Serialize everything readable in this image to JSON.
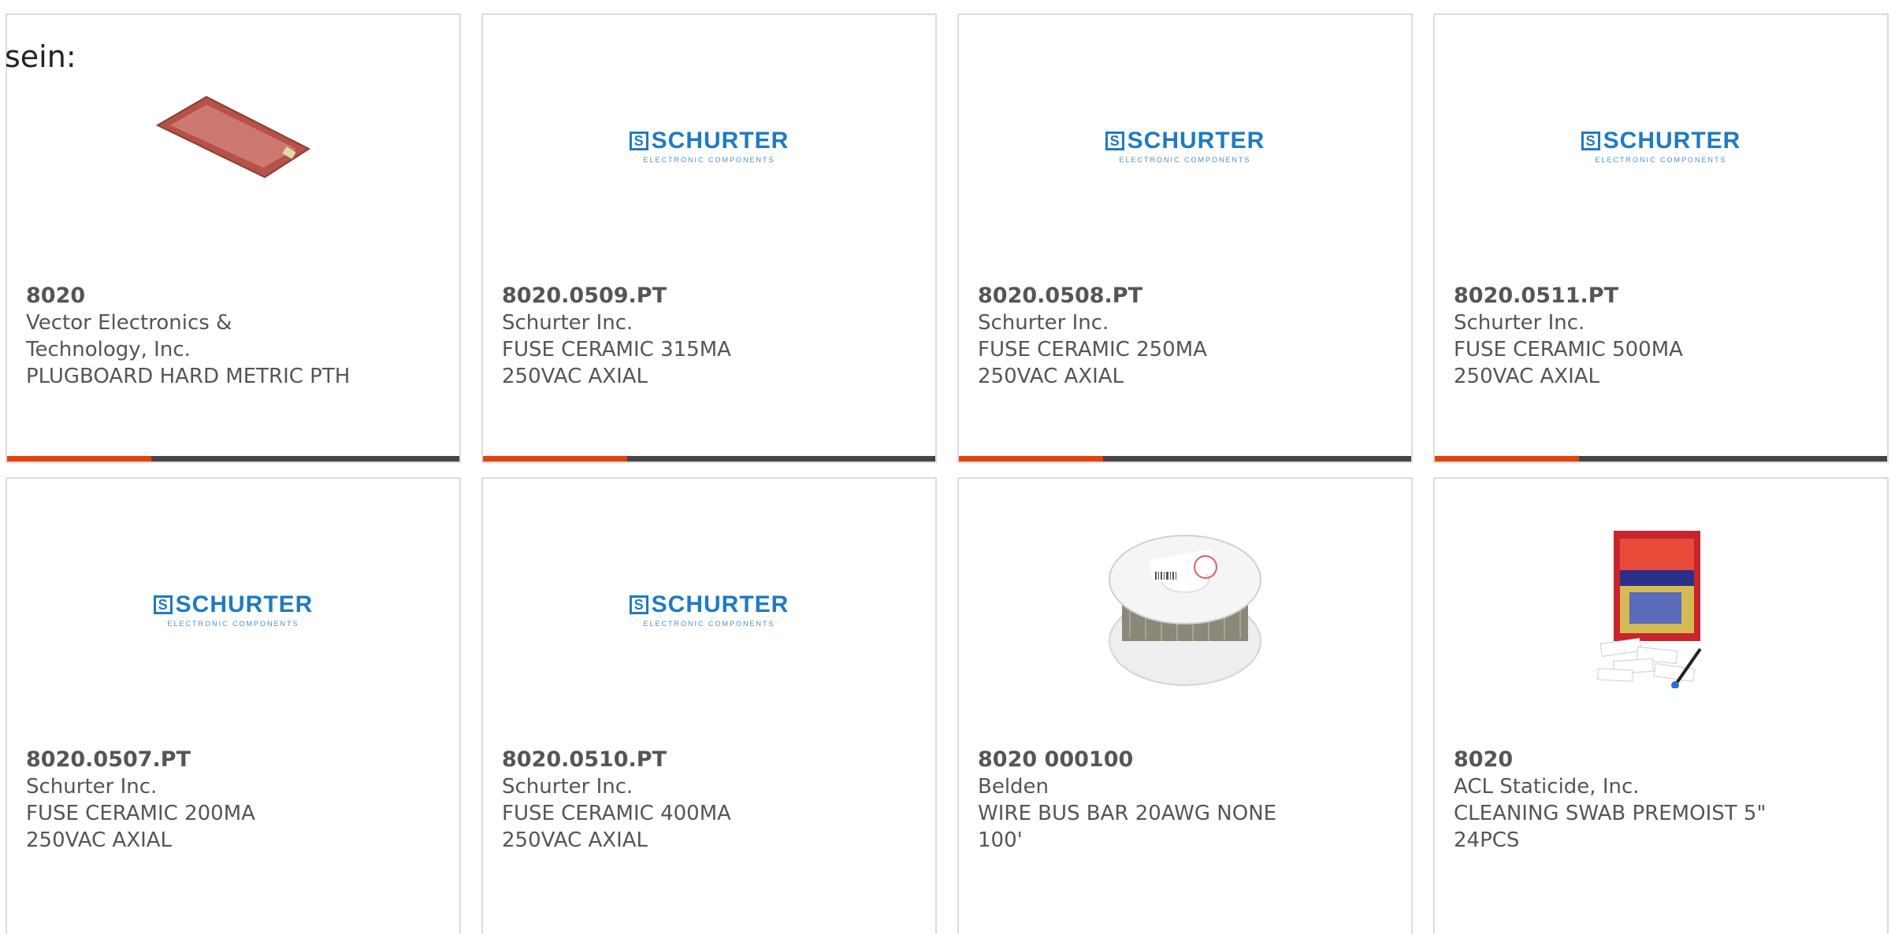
{
  "intro_text": "sein:",
  "logo": {
    "mark": "S",
    "word": "SCHURTER",
    "sub": "ELECTRONIC COMPONENTS"
  },
  "products": [
    {
      "pn": "8020",
      "maker": "Vector Electronics & Technology, Inc.",
      "desc": "PLUGBOARD HARD METRIC PTH",
      "image": "plugboard"
    },
    {
      "pn": "8020.0509.PT",
      "maker": "Schurter Inc.",
      "desc": "FUSE CERAMIC 315MA 250VAC AXIAL",
      "image": "schurter-logo"
    },
    {
      "pn": "8020.0508.PT",
      "maker": "Schurter Inc.",
      "desc": "FUSE CERAMIC 250MA 250VAC AXIAL",
      "image": "schurter-logo"
    },
    {
      "pn": "8020.0511.PT",
      "maker": "Schurter Inc.",
      "desc": "FUSE CERAMIC 500MA 250VAC AXIAL",
      "image": "schurter-logo"
    },
    {
      "pn": "8020.0507.PT",
      "maker": "Schurter Inc.",
      "desc": "FUSE CERAMIC 200MA 250VAC AXIAL",
      "image": "schurter-logo"
    },
    {
      "pn": "8020.0510.PT",
      "maker": "Schurter Inc.",
      "desc": "FUSE CERAMIC 400MA 250VAC AXIAL",
      "image": "schurter-logo"
    },
    {
      "pn": "8020 000100",
      "maker": "Belden",
      "desc": "WIRE BUS BAR 20AWG NONE 100'",
      "image": "wire-spool"
    },
    {
      "pn": "8020",
      "maker": "ACL Staticide, Inc.",
      "desc": "CLEANING SWAB PREMOIST 5\" 24PCS",
      "image": "swab-pack"
    }
  ],
  "colors": {
    "accent": "#e8400c",
    "bar": "#454545",
    "logo_blue": "#1f7ac4"
  }
}
